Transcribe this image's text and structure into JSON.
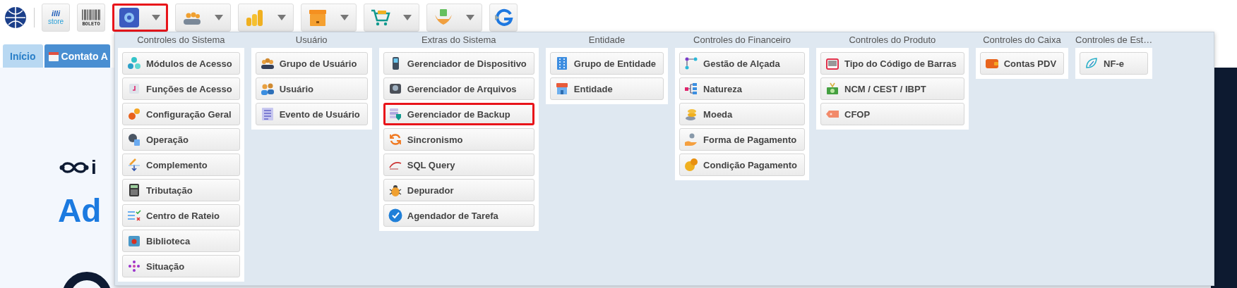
{
  "toolbar": {
    "store_logo": {
      "line_1": "illi",
      "line_2": "store"
    },
    "boleto_label": "BOLETO",
    "dropdowns": [
      {
        "highlighted": true
      },
      {
        "highlighted": false
      },
      {
        "highlighted": false
      },
      {
        "highlighted": false
      },
      {
        "highlighted": false
      },
      {
        "highlighted": false
      }
    ]
  },
  "tabs": [
    {
      "label": "Início",
      "selected": false
    },
    {
      "label": "Contato A",
      "selected": true
    }
  ],
  "background": {
    "brand_text": "i",
    "heading": "Ad"
  },
  "menu": {
    "columns": [
      {
        "title": "Controles do Sistema",
        "items": [
          {
            "label": "Módulos de Acesso",
            "highlighted": false
          },
          {
            "label": "Funções de Acesso",
            "highlighted": false
          },
          {
            "label": "Configuração Geral",
            "highlighted": false
          },
          {
            "label": "Operação",
            "highlighted": false
          },
          {
            "label": "Complemento",
            "highlighted": false
          },
          {
            "label": "Tributação",
            "highlighted": false
          },
          {
            "label": "Centro de Rateio",
            "highlighted": false
          },
          {
            "label": "Biblioteca",
            "highlighted": false
          },
          {
            "label": "Situação",
            "highlighted": false
          }
        ]
      },
      {
        "title": "Usuário",
        "items": [
          {
            "label": "Grupo de Usuário",
            "highlighted": false
          },
          {
            "label": "Usuário",
            "highlighted": false
          },
          {
            "label": "Evento de Usuário",
            "highlighted": false
          }
        ]
      },
      {
        "title": "Extras do Sistema",
        "items": [
          {
            "label": "Gerenciador de Dispositivo",
            "highlighted": false
          },
          {
            "label": "Gerenciador de Arquivos",
            "highlighted": false
          },
          {
            "label": "Gerenciador de Backup",
            "highlighted": true
          },
          {
            "label": "Sincronismo",
            "highlighted": false
          },
          {
            "label": "SQL Query",
            "highlighted": false
          },
          {
            "label": "Depurador",
            "highlighted": false
          },
          {
            "label": "Agendador de Tarefa",
            "highlighted": false
          }
        ]
      },
      {
        "title": "Entidade",
        "items": [
          {
            "label": "Grupo de Entidade",
            "highlighted": false
          },
          {
            "label": "Entidade",
            "highlighted": false
          }
        ]
      },
      {
        "title": "Controles do Financeiro",
        "items": [
          {
            "label": "Gestão de Alçada",
            "highlighted": false
          },
          {
            "label": "Natureza",
            "highlighted": false
          },
          {
            "label": "Moeda",
            "highlighted": false
          },
          {
            "label": "Forma de Pagamento",
            "highlighted": false
          },
          {
            "label": "Condição Pagamento",
            "highlighted": false
          }
        ]
      },
      {
        "title": "Controles do Produto",
        "items": [
          {
            "label": "Tipo do Código de Barras",
            "highlighted": false
          },
          {
            "label": "NCM / CEST / IBPT",
            "highlighted": false
          },
          {
            "label": "CFOP",
            "highlighted": false
          }
        ]
      },
      {
        "title": "Controles do Caixa",
        "items": [
          {
            "label": "Contas PDV",
            "highlighted": false
          }
        ]
      },
      {
        "title": "Controles de Est…",
        "items": [
          {
            "label": "NF-e",
            "highlighted": false
          }
        ]
      }
    ]
  }
}
